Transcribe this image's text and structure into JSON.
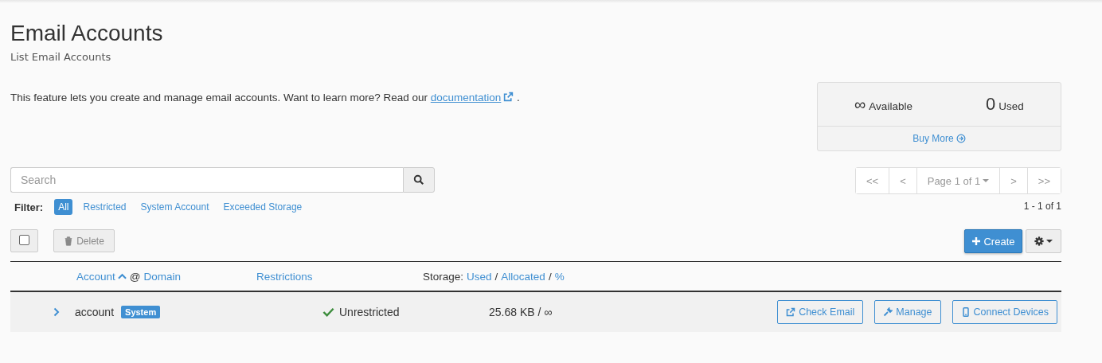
{
  "page": {
    "title": "Email Accounts",
    "subtitle": "List Email Accounts"
  },
  "intro": {
    "text": "This feature lets you create and manage email accounts. Want to learn more? Read our",
    "link": "documentation",
    "after": "."
  },
  "stats": {
    "available_value": "∞",
    "available_label": "Available",
    "used_value": "0",
    "used_label": "Used",
    "buy_more": "Buy More"
  },
  "search": {
    "placeholder": "Search"
  },
  "pagination": {
    "first": "<<",
    "prev": "<",
    "page": "Page 1 of 1",
    "next": ">",
    "last": ">>",
    "range": "1 - 1 of 1"
  },
  "filter": {
    "label": "Filter:",
    "options": [
      {
        "label": "All",
        "selected": true
      },
      {
        "label": "Restricted",
        "selected": false
      },
      {
        "label": "System Account",
        "selected": false
      },
      {
        "label": "Exceeded Storage",
        "selected": false
      }
    ]
  },
  "toolbar": {
    "select_all_checked": false,
    "delete": "Delete",
    "delete_disabled": true,
    "create": "Create"
  },
  "table": {
    "columns": [
      {
        "parts": [
          {
            "kind": "link",
            "text": "Account",
            "sorted": true
          },
          {
            "kind": "text",
            "text": "@"
          },
          {
            "kind": "link",
            "text": "Domain"
          }
        ]
      },
      {
        "parts": [
          {
            "kind": "link",
            "text": "Restrictions"
          }
        ]
      },
      {
        "parts": [
          {
            "kind": "text",
            "text": "Storage:"
          },
          {
            "kind": "link",
            "text": "Used"
          },
          {
            "kind": "text",
            "text": "/"
          },
          {
            "kind": "link",
            "text": "Allocated"
          },
          {
            "kind": "text",
            "text": "/"
          },
          {
            "kind": "link",
            "text": "%"
          }
        ]
      }
    ],
    "rows": [
      {
        "expanded": false,
        "account": "account",
        "badge": "System",
        "restriction": "Unrestricted",
        "storage": "25.68 KB / ∞",
        "actions": [
          {
            "kind": "check",
            "label": "Check Email"
          },
          {
            "kind": "manage",
            "label": "Manage"
          },
          {
            "kind": "devices",
            "label": "Connect Devices"
          }
        ]
      }
    ]
  }
}
